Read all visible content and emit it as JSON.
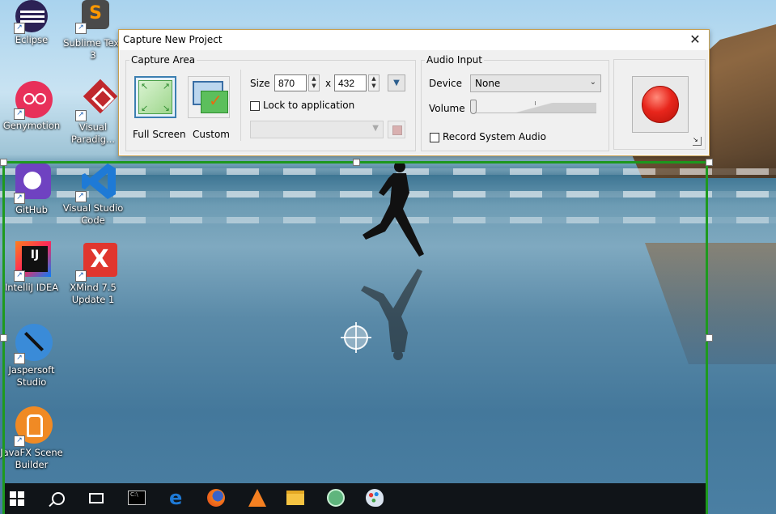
{
  "desktop": {
    "icons": [
      {
        "label": "Eclipse",
        "icon": "eclipse-icon",
        "color": "#2c2255"
      },
      {
        "label": "Sublime Text 3",
        "icon": "sublime-text-icon",
        "color": "#4a4a4a"
      },
      {
        "label": "Genymotion",
        "icon": "genymotion-icon",
        "color": "#e8305a"
      },
      {
        "label": "Visual Paradig...",
        "icon": "visual-paradigm-icon",
        "color": "#c0282d"
      },
      {
        "label": "GitHub",
        "icon": "github-icon",
        "color": "#6f42c1"
      },
      {
        "label": "Visual Studio Code",
        "icon": "vscode-icon",
        "color": "#1e7ad6"
      },
      {
        "label": "IntelliJ IDEA",
        "icon": "intellij-icon",
        "color": "#111111"
      },
      {
        "label": "XMind 7.5 Update 1",
        "icon": "xmind-icon",
        "color": "#e0362e"
      },
      {
        "label": "Jaspersoft Studio",
        "icon": "jaspersoft-icon",
        "color": "#3a8bd8"
      },
      {
        "label": "JavaFX Scene Builder",
        "icon": "scene-builder-icon",
        "color": "#f08a24"
      }
    ]
  },
  "dialog": {
    "title": "Capture New Project",
    "close_glyph": "✕",
    "capture_area": {
      "legend": "Capture Area",
      "full_screen_label": "Full Screen",
      "custom_label": "Custom",
      "size_label": "Size",
      "width": "870",
      "times": "x",
      "height": "432",
      "lock_label": "Lock to application",
      "lock_checked": false
    },
    "audio_input": {
      "legend": "Audio Input",
      "device_label": "Device",
      "device_value": "None",
      "volume_label": "Volume",
      "volume_level": 0,
      "record_system_label": "Record System Audio",
      "record_system_checked": false
    },
    "record_button_color": "#e8261c"
  },
  "taskbar": {
    "items": [
      {
        "icon": "windows-start-icon"
      },
      {
        "icon": "search-icon"
      },
      {
        "icon": "task-view-icon"
      },
      {
        "icon": "command-prompt-icon"
      },
      {
        "icon": "edge-icon"
      },
      {
        "icon": "firefox-icon"
      },
      {
        "icon": "vlc-icon"
      },
      {
        "icon": "file-explorer-icon"
      },
      {
        "icon": "atom-icon"
      },
      {
        "icon": "paint-icon"
      }
    ]
  }
}
